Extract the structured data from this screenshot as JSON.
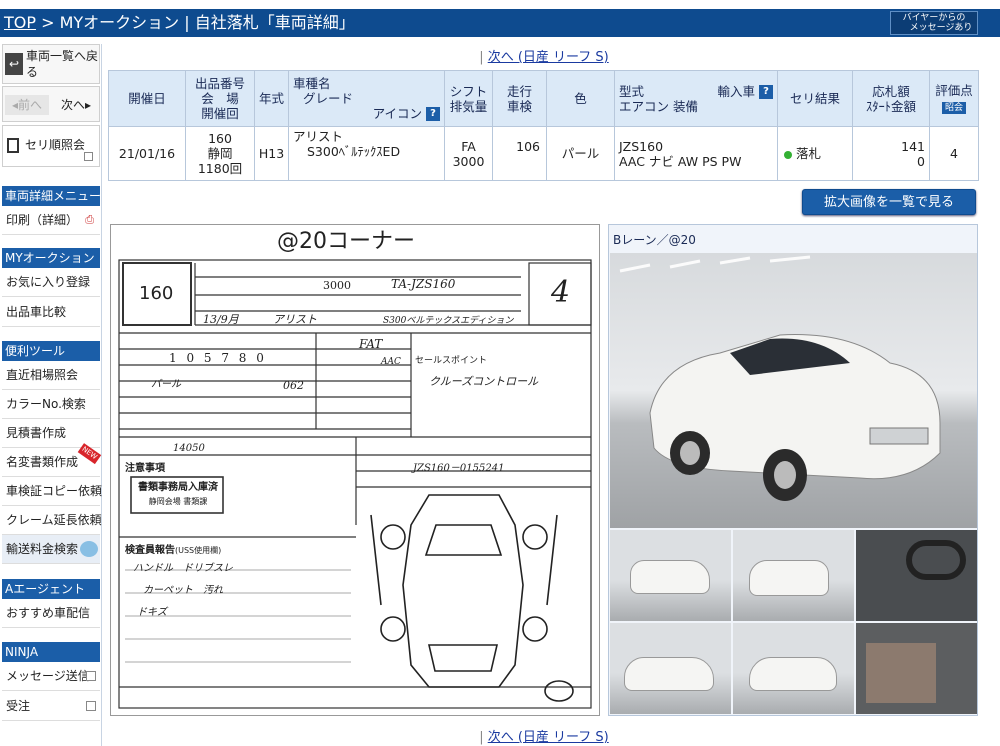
{
  "header": {
    "crumb_top": "TOP",
    "crumb_rest": " > MYオークション | 自社落札「車両詳細」",
    "msg_button_line1": "バイヤーからの",
    "msg_button_line2": "メッセージあり"
  },
  "sidebar": {
    "list_link": "車両一覧へ戻る",
    "prev": "◂前へ",
    "next": "次へ▸",
    "seri_order": "セリ順照会",
    "sections": [
      {
        "head": "車両詳細メニュー",
        "items": [
          "印刷（詳細）"
        ]
      },
      {
        "head": "MYオークション",
        "items": [
          "お気に入り登録",
          "出品車比較"
        ]
      },
      {
        "head": "便利ツール",
        "items": [
          "直近相場照会",
          "カラーNo.検索",
          "見積書作成",
          "名変書類作成",
          "車検証コピー依頼",
          "クレーム延長依頼",
          "輸送料金検索"
        ]
      },
      {
        "head": "Aエージェント",
        "items": [
          "おすすめ車配信"
        ]
      },
      {
        "head": "NINJA",
        "items": [
          "メッセージ送信",
          "受注"
        ]
      }
    ],
    "new_badge": "NEW"
  },
  "nav": {
    "next_link": "次へ (日産 リーフ S)"
  },
  "table": {
    "headers": {
      "date": "開催日",
      "lot_line1": "出品番号",
      "lot_line2": "会　場",
      "lot_line3": "開催回",
      "year": "年式",
      "model_line1": "車種名",
      "model_line2": "グレード",
      "model_line3": "アイコン",
      "shift_line1": "シフト",
      "shift_line2": "排気量",
      "mileage_line1": "走行",
      "mileage_line2": "車検",
      "color": "色",
      "type_line1": "型式",
      "type_line2": "エアコン 装備",
      "import": "輸入車",
      "result": "セリ結果",
      "bid_line1": "応札額",
      "bid_line2": "ｽﾀｰﾄ金額",
      "eval": "評価点",
      "eval_badge": "昭会"
    },
    "row": {
      "date": "21/01/16",
      "lot": "160",
      "venue": "静岡",
      "session": "1180回",
      "year": "H13",
      "model": "アリスト",
      "grade": "S300ﾍﾞﾙﾃｯｸｽED",
      "shift": "FA",
      "displacement": "3000",
      "mileage": "106",
      "color": "パール",
      "type": "JZS160",
      "equipment": "AAC ナビ AW PS PW",
      "result": "落札",
      "bid_line1": "141",
      "bid_line2": "0",
      "eval": "4"
    }
  },
  "zoom_button": "拡大画像を一覧で見る",
  "sheet": {
    "title": "@20コーナー",
    "lot": "160",
    "cc": "3000",
    "type_hand": "TA-JZS160",
    "eval_hand": "4",
    "year_hand": "13/9月",
    "name_hand": "アリスト",
    "grade_hand": "S300ベルテックスエディション",
    "mileage_hand": "1 0 5 7 8 0",
    "shift_hand": "FAT",
    "ac_hand": "AAC",
    "color_hand": "パール",
    "color_no": "062",
    "recycle": "14050",
    "chassis": "JZS160－0155241",
    "point_hand": "クルーズコントロール",
    "notes_hand": [
      "ハンドル　ドリブスレ",
      "カーペット　汚れ",
      "ドキズ"
    ],
    "stamp_line1": "書類事務局入庫済",
    "stamp_line2": "静岡会場 書類課",
    "label_seri": "セールスポイント",
    "label_notice": "注意事項",
    "label_inspect": "検査員報告",
    "label_inspect_tail": "(USS使用欄)"
  },
  "photos": {
    "lane_label": "Bレーン／@20"
  },
  "colors": {
    "header_bg": "#0e4b8f",
    "accent": "#1b5ea8",
    "table_head": "#dbe9f7"
  }
}
